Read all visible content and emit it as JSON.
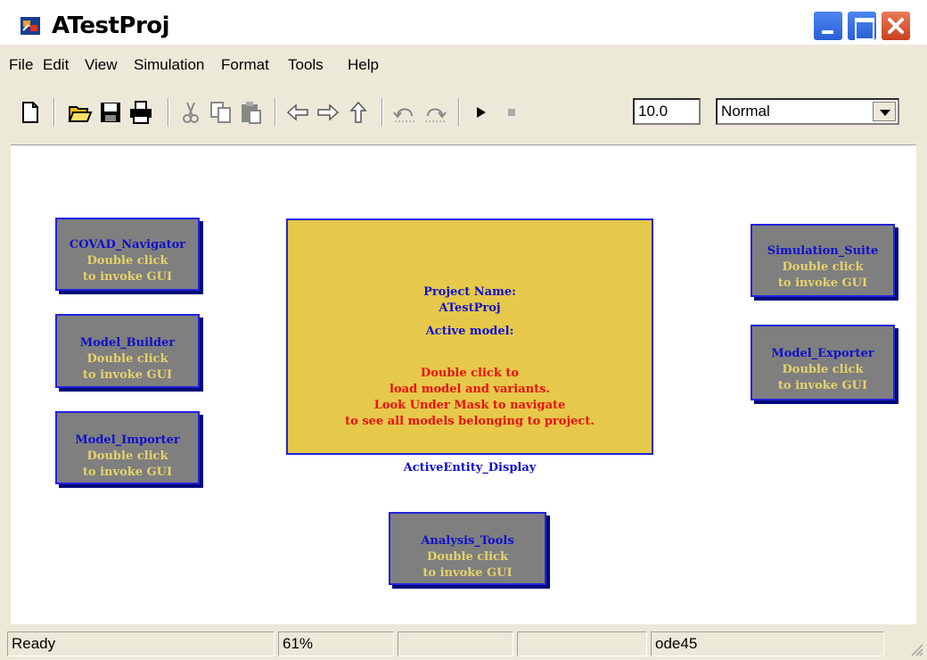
{
  "window": {
    "title": "ATestProj"
  },
  "menu": [
    "File",
    "Edit",
    "View",
    "Simulation",
    "Format",
    "Tools",
    "Help"
  ],
  "toolbar": {
    "stop_time": "10.0",
    "sim_mode": "Normal",
    "icons": [
      "new-icon",
      "open-icon",
      "save-icon",
      "print-icon",
      "cut-icon",
      "copy-icon",
      "paste-icon",
      "back-icon",
      "forward-icon",
      "up-icon",
      "undo-icon",
      "redo-icon",
      "play-icon",
      "stop-icon"
    ]
  },
  "blocks": [
    {
      "name": "COVAD_Navigator",
      "hint1": "Double click",
      "hint2": "to invoke GUI"
    },
    {
      "name": "Model_Builder",
      "hint1": "Double click",
      "hint2": "to invoke GUI"
    },
    {
      "name": "Model_Importer",
      "hint1": "Double click",
      "hint2": "to invoke GUI"
    },
    {
      "name": "Simulation_Suite",
      "hint1": "Double click",
      "hint2": "to invoke GUI"
    },
    {
      "name": "Model_Exporter",
      "hint1": "Double click",
      "hint2": "to invoke GUI"
    },
    {
      "name": "Analysis_Tools",
      "hint1": "Double click",
      "hint2": "to invoke GUI"
    }
  ],
  "display": {
    "project_label": "Project Name:",
    "project_name": "ATestProj",
    "active_model_label": "Active model:",
    "instructions": [
      "Double click to",
      "load model and variants.",
      "Look Under Mask to navigate",
      "to see all models belonging to project."
    ],
    "caption": "ActiveEntity_Display"
  },
  "status": {
    "state": "Ready",
    "zoom": "61%",
    "solver": "ode45"
  },
  "colors": {
    "block_fill": "#7f7f7f",
    "block_border": "#2222dd",
    "block_name": "#1010cc",
    "block_hint": "#e6d26b",
    "display_fill": "#e6c84a",
    "instruction_text": "#e81010"
  }
}
